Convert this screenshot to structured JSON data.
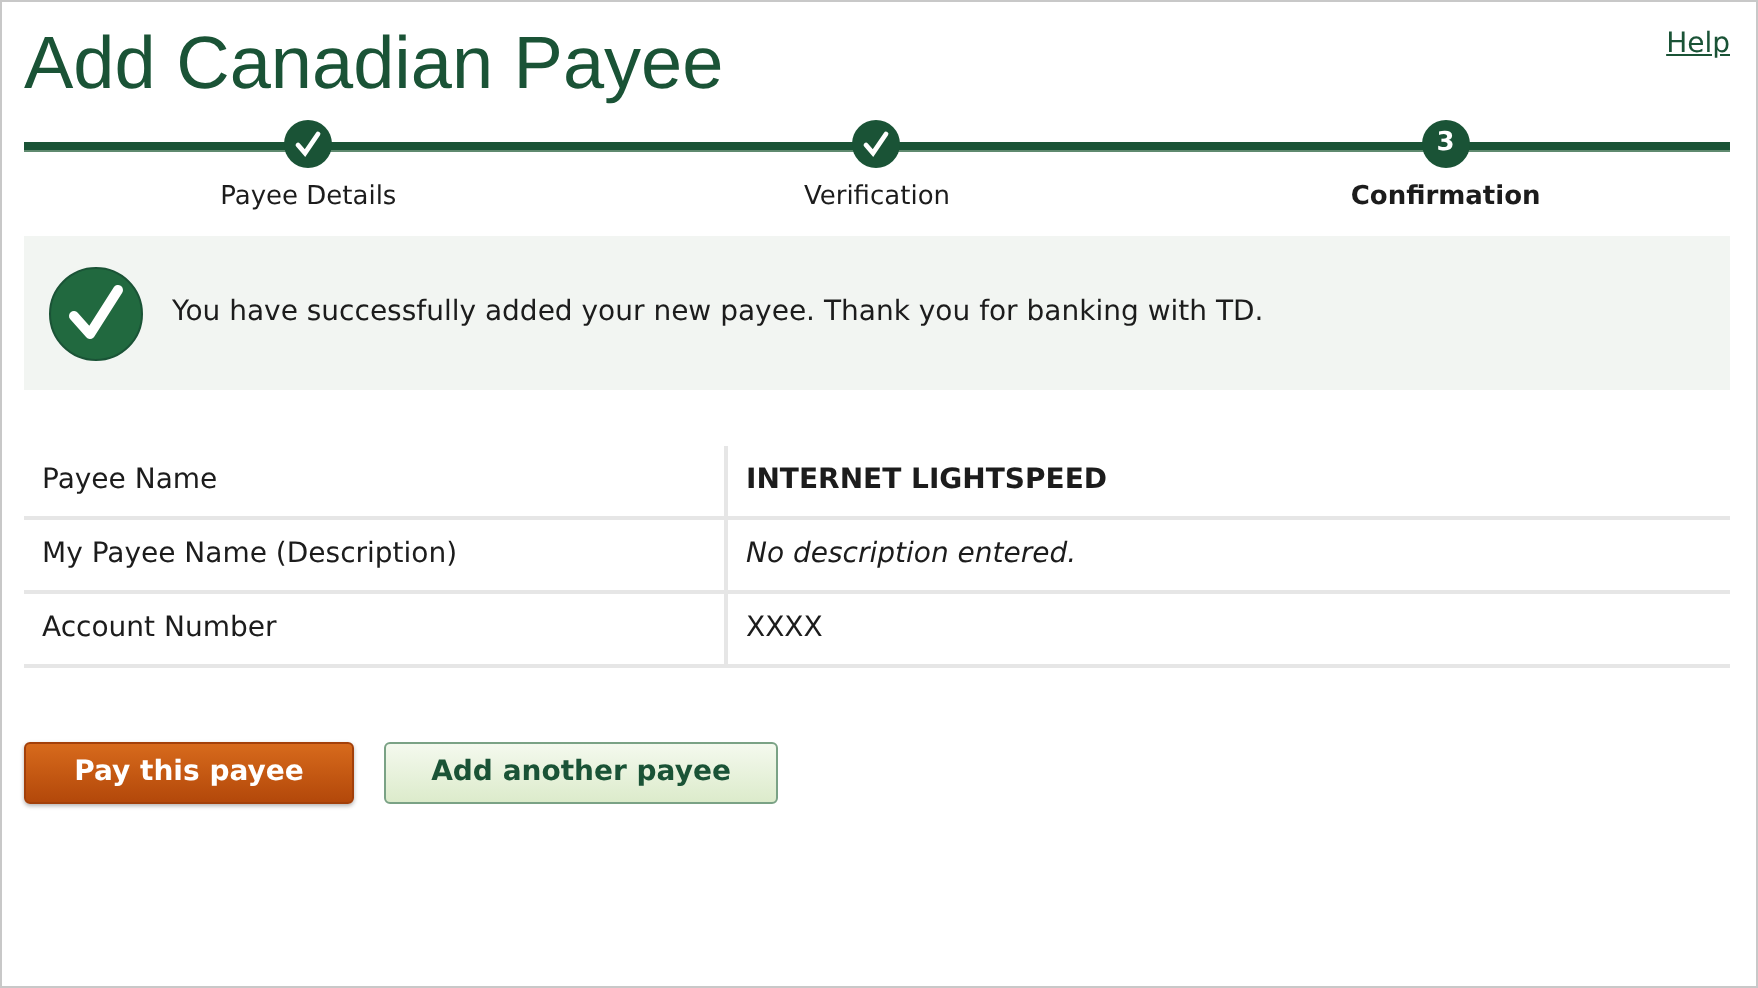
{
  "page": {
    "title": "Add Canadian Payee",
    "help_link": "Help"
  },
  "steps": [
    {
      "label": "Payee Details",
      "kind": "done",
      "selected": false
    },
    {
      "label": "Verification",
      "kind": "done",
      "selected": false
    },
    {
      "label": "Confirmation",
      "kind": "current",
      "number": "3",
      "selected": true
    }
  ],
  "message": {
    "text": "You have successfully added your new payee. Thank you for banking with TD."
  },
  "details": [
    {
      "label": "Payee Name",
      "value": "INTERNET LIGHTSPEED",
      "kind": "bold"
    },
    {
      "label": "My Payee Name (Description)",
      "value": "No description entered.",
      "kind": "italic"
    },
    {
      "label": "Account Number",
      "value": "XXXX",
      "kind": "plain"
    }
  ],
  "buttons": [
    {
      "label": "Pay this payee",
      "kind": "primary"
    },
    {
      "label": "Add another payee",
      "kind": "secondary"
    }
  ]
}
